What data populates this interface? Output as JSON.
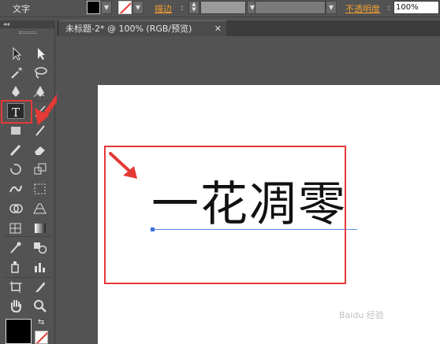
{
  "control_bar": {
    "tool_name": "文字",
    "stroke_label": "描边",
    "opacity_label": "不透明度",
    "opacity_value": "100%"
  },
  "document_tab": {
    "title": "未标题-2* @ 100% (RGB/预览)",
    "close_glyph": "✕"
  },
  "artboard": {
    "text": "一花凋零"
  },
  "tools": [
    "selection-tool",
    "direct-selection-tool",
    "magic-wand-tool",
    "lasso-tool",
    "pen-tool",
    "curvature-tool",
    "type-tool",
    "line-segment-tool",
    "rectangle-tool",
    "paintbrush-tool",
    "pencil-tool",
    "eraser-tool",
    "rotate-tool",
    "scale-tool",
    "warp-tool",
    "free-transform-tool",
    "shape-builder-tool",
    "perspective-grid-tool",
    "mesh-tool",
    "gradient-tool",
    "eyedropper-tool",
    "blend-tool",
    "symbol-sprayer-tool",
    "column-graph-tool",
    "artboard-tool",
    "slice-tool",
    "hand-tool",
    "zoom-tool"
  ],
  "colors": {
    "annotation_red": "#e53935",
    "accent_orange": "#f0a030",
    "baseline_blue": "#5b8ef0"
  },
  "watermark": "Baidu 经验"
}
